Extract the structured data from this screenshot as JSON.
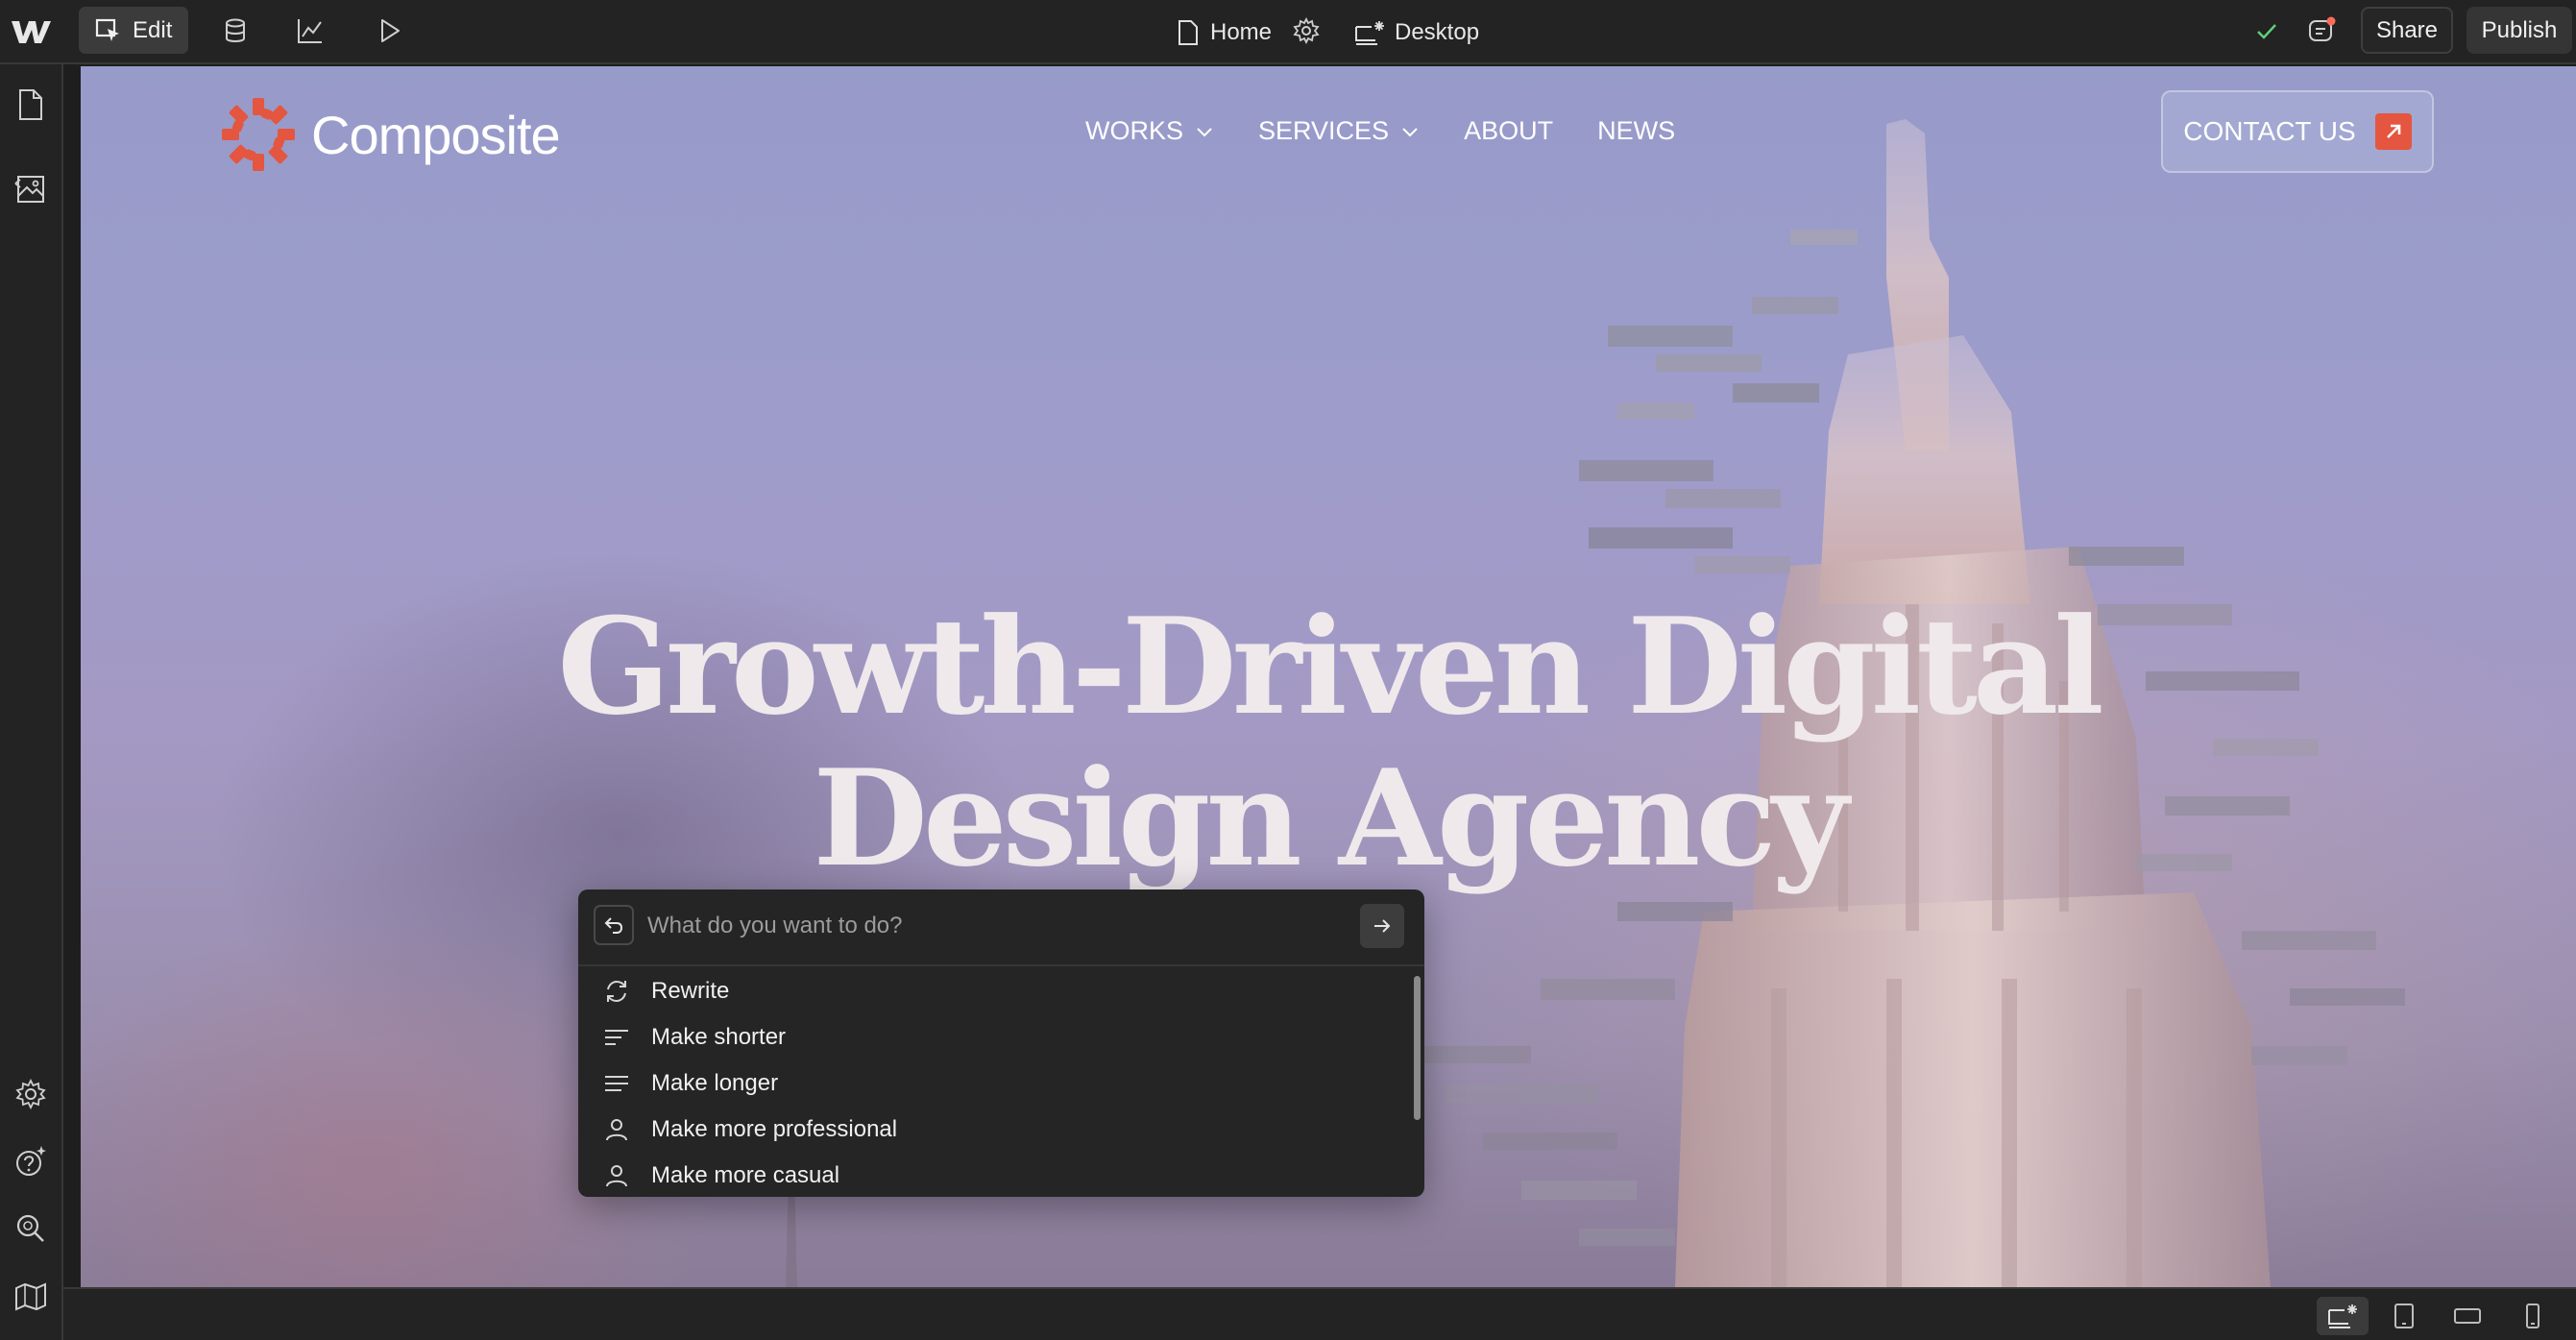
{
  "toolbar": {
    "edit_label": "Edit",
    "page_name": "Home",
    "breakpoint_label": "Desktop",
    "share_label": "Share",
    "publish_label": "Publish"
  },
  "site": {
    "logo_text": "Composite",
    "nav": [
      {
        "label": "WORKS",
        "has_dropdown": true
      },
      {
        "label": "SERVICES",
        "has_dropdown": true
      },
      {
        "label": "ABOUT",
        "has_dropdown": false
      },
      {
        "label": "NEWS",
        "has_dropdown": false
      }
    ],
    "contact_label": "CONTACT US",
    "hero_line1": "Growth-Driven Digital",
    "hero_line2": "Design Agency",
    "brand_color": "#e4563f"
  },
  "ai_popup": {
    "placeholder": "What do you want to do?",
    "items": [
      {
        "label": "Rewrite",
        "icon": "refresh-icon"
      },
      {
        "label": "Make shorter",
        "icon": "text-lines-short-icon"
      },
      {
        "label": "Make longer",
        "icon": "text-lines-long-icon"
      },
      {
        "label": "Make more professional",
        "icon": "person-icon"
      },
      {
        "label": "Make more casual",
        "icon": "person-icon"
      }
    ]
  },
  "colors": {
    "chrome_bg": "#232323",
    "accent": "#e4563f"
  }
}
